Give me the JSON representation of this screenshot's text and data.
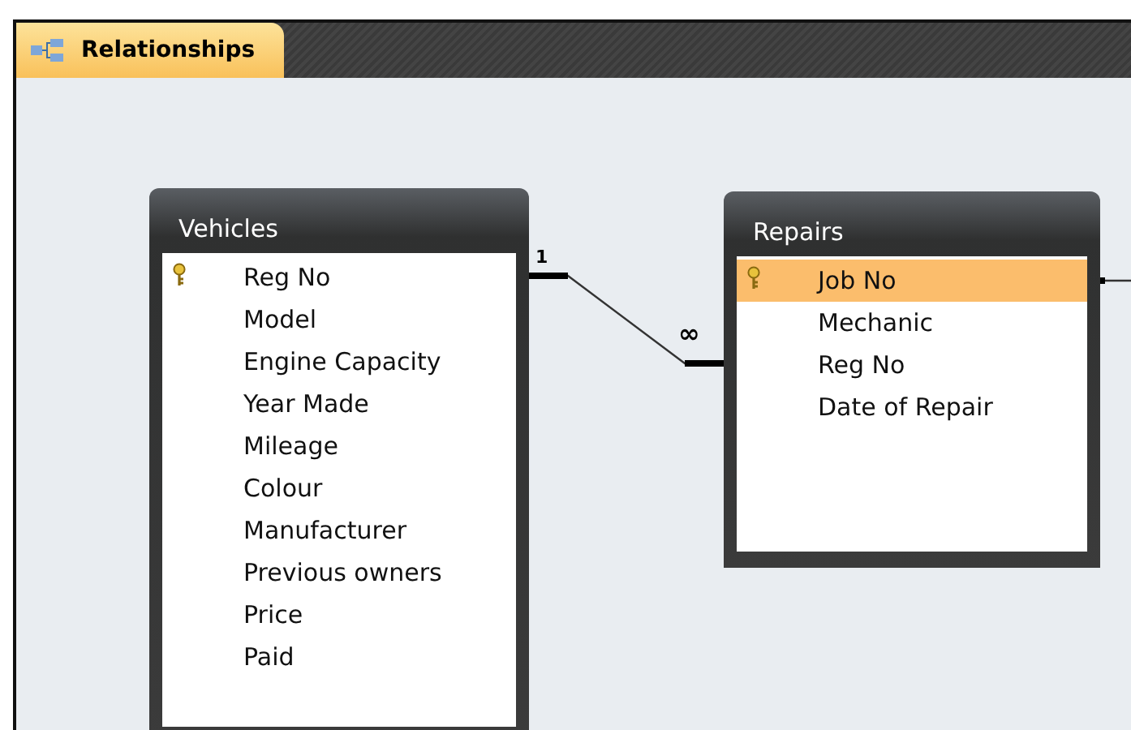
{
  "tab": {
    "label": "Relationships",
    "selected": true
  },
  "tables": [
    {
      "name": "Vehicles",
      "fields": [
        {
          "label": "Reg No",
          "primary_key": true,
          "selected": false
        },
        {
          "label": "Model",
          "primary_key": false,
          "selected": false
        },
        {
          "label": "Engine Capacity",
          "primary_key": false,
          "selected": false
        },
        {
          "label": "Year Made",
          "primary_key": false,
          "selected": false
        },
        {
          "label": "Mileage",
          "primary_key": false,
          "selected": false
        },
        {
          "label": "Colour",
          "primary_key": false,
          "selected": false
        },
        {
          "label": "Manufacturer",
          "primary_key": false,
          "selected": false
        },
        {
          "label": "Previous owners",
          "primary_key": false,
          "selected": false
        },
        {
          "label": "Price",
          "primary_key": false,
          "selected": false
        },
        {
          "label": "Paid",
          "primary_key": false,
          "selected": false
        }
      ]
    },
    {
      "name": "Repairs",
      "fields": [
        {
          "label": "Job No",
          "primary_key": true,
          "selected": true
        },
        {
          "label": "Mechanic",
          "primary_key": false,
          "selected": false
        },
        {
          "label": "Reg No",
          "primary_key": false,
          "selected": false
        },
        {
          "label": "Date of Repair",
          "primary_key": false,
          "selected": false
        }
      ]
    }
  ],
  "relationships": [
    {
      "one_label": "1",
      "many_label": "∞"
    }
  ]
}
